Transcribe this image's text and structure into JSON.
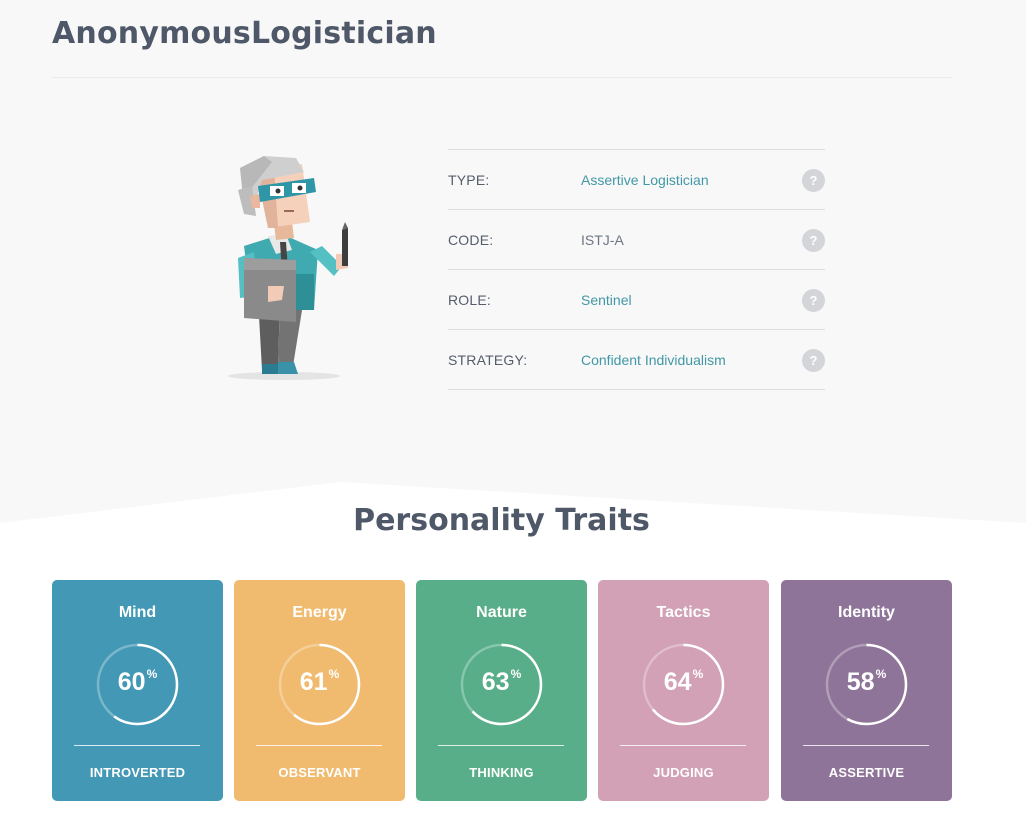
{
  "profile": {
    "username": "AnonymousLogistician"
  },
  "info": [
    {
      "label": "TYPE:",
      "value": "Assertive Logistician",
      "link": true,
      "help": "?"
    },
    {
      "label": "CODE:",
      "value": "ISTJ-A",
      "link": false,
      "help": "?"
    },
    {
      "label": "ROLE:",
      "value": "Sentinel",
      "link": true,
      "help": "?"
    },
    {
      "label": "STRATEGY:",
      "value": "Confident Individualism",
      "link": true,
      "help": "?"
    }
  ],
  "traits_heading": "Personality Traits",
  "traits": [
    {
      "name": "Mind",
      "percent": 60,
      "pct_label": "60",
      "trait": "INTROVERTED",
      "color": "#4298b5"
    },
    {
      "name": "Energy",
      "percent": 61,
      "pct_label": "61",
      "trait": "OBSERVANT",
      "color": "#f0bb6f"
    },
    {
      "name": "Nature",
      "percent": 63,
      "pct_label": "63",
      "trait": "THINKING",
      "color": "#58ae88"
    },
    {
      "name": "Tactics",
      "percent": 64,
      "pct_label": "64",
      "trait": "JUDGING",
      "color": "#d2a1b5"
    },
    {
      "name": "Identity",
      "percent": 58,
      "pct_label": "58",
      "trait": "ASSERTIVE",
      "color": "#8f7499"
    }
  ],
  "percent_sign": "%",
  "colors": {
    "link": "#4298a6",
    "heading": "#4f5868",
    "help_bg": "#d3d5d8"
  }
}
